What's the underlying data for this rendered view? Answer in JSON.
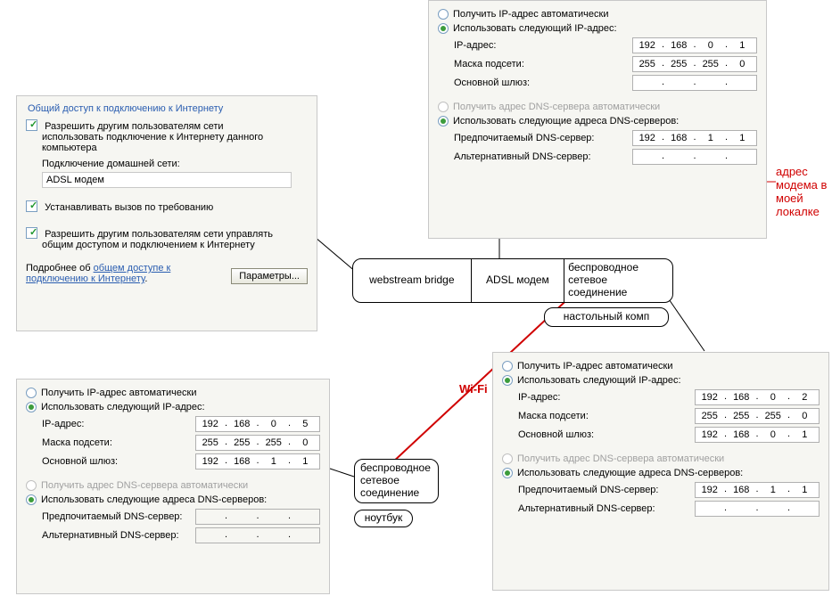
{
  "sharing_panel": {
    "title": "Общий доступ к подключению к Интернету",
    "allow_other_line1": "Разрешить другим пользователям сети",
    "allow_other_line2": "использовать подключение к Интернету данного",
    "allow_other_line3": "компьютера",
    "home_conn_label": "Подключение домашней сети:",
    "home_conn_value": "ADSL модем",
    "dial_on_demand": "Устанавливать вызов по требованию",
    "allow_control_line1": "Разрешить другим пользователям сети управлять",
    "allow_control_line2": "общим доступом и подключением к Интернету",
    "more_about_prefix": "Подробнее об ",
    "more_about_link1": "общем доступе к",
    "more_about_link2": "подключению к Интернету",
    "params_btn": "Параметры..."
  },
  "ip_labels": {
    "auto_ip": "Получить IP-адрес автоматически",
    "use_ip": "Использовать следующий IP-адрес:",
    "ip": "IP-адрес:",
    "mask": "Маска подсети:",
    "gateway": "Основной шлюз:",
    "auto_dns": "Получить адрес DNS-сервера автоматически",
    "use_dns": "Использовать следующие адреса DNS-серверов:",
    "pref_dns": "Предпочитаемый DNS-сервер:",
    "alt_dns": "Альтернативный DNS-сервер:"
  },
  "top_ip": {
    "ip": [
      "192",
      "168",
      "0",
      "1"
    ],
    "mask": [
      "255",
      "255",
      "255",
      "0"
    ],
    "gw": [
      "",
      "",
      "",
      ""
    ],
    "pdns": [
      "192",
      "168",
      "1",
      "1"
    ],
    "adns": [
      "",
      "",
      "",
      ""
    ]
  },
  "right_ip": {
    "ip": [
      "192",
      "168",
      "0",
      "2"
    ],
    "mask": [
      "255",
      "255",
      "255",
      "0"
    ],
    "gw": [
      "192",
      "168",
      "0",
      "1"
    ],
    "pdns": [
      "192",
      "168",
      "1",
      "1"
    ],
    "adns": [
      "",
      "",
      "",
      ""
    ]
  },
  "left_ip": {
    "ip": [
      "192",
      "168",
      "0",
      "5"
    ],
    "mask": [
      "255",
      "255",
      "255",
      "0"
    ],
    "gw": [
      "192",
      "168",
      "1",
      "1"
    ],
    "pdns": [
      "",
      "",
      "",
      ""
    ],
    "adns": [
      "",
      "",
      "",
      ""
    ]
  },
  "diagram": {
    "webstream": "webstream bridge",
    "adsl": "ADSL модем",
    "wireless1": "беспроводное",
    "wireless2": "сетевое",
    "wireless3": "соединение",
    "desktop": "настольный комп",
    "notebook": "ноутбук",
    "wifi": "Wi-Fi"
  },
  "callout": {
    "l1": "адрес",
    "l2": "модема в",
    "l3": "моей",
    "l4": "локалке"
  }
}
